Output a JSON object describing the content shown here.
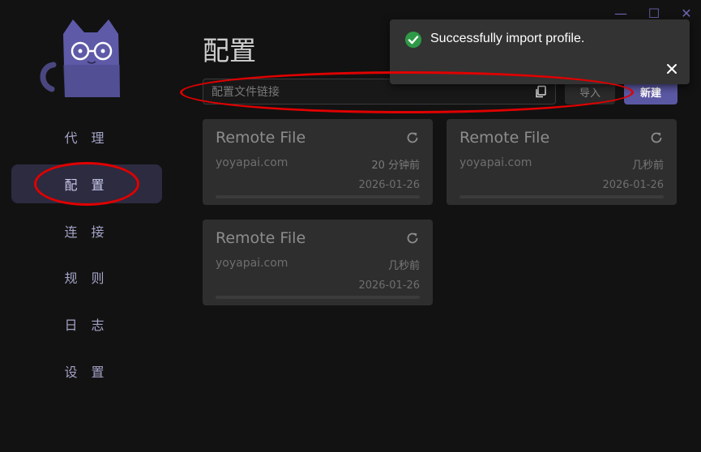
{
  "window": {
    "minimize_glyph": "—",
    "maximize_glyph": "☐",
    "close_glyph": "✕"
  },
  "sidebar": {
    "logo_icon": "cat-with-glasses-logo-icon",
    "items": [
      {
        "label": "代 理"
      },
      {
        "label": "配 置"
      },
      {
        "label": "连 接"
      },
      {
        "label": "规 则"
      },
      {
        "label": "日 志"
      },
      {
        "label": "设 置"
      }
    ],
    "active_index": 1,
    "active_color": "#2c2b40"
  },
  "main": {
    "title": "配置",
    "url_input": {
      "placeholder": "配置文件链接",
      "value": ""
    },
    "copy_icon": "copy-icon",
    "import_label": "导入",
    "new_label": "新建",
    "accent_color": "#5b58a3"
  },
  "profiles": [
    {
      "title": "Remote File",
      "host": "yoyapai.com",
      "updated": "20 分钟前",
      "date": "2026-01-26"
    },
    {
      "title": "Remote File",
      "host": "yoyapai.com",
      "updated": "几秒前",
      "date": "2026-01-26"
    },
    {
      "title": "Remote File",
      "host": "yoyapai.com",
      "updated": "几秒前",
      "date": "2026-01-26"
    }
  ],
  "toast": {
    "message": "Successfully import profile.",
    "status_icon": "check-circle-icon",
    "status_color": "#2e9a48",
    "close_icon": "close-icon"
  },
  "annotation_color": "#e00000"
}
